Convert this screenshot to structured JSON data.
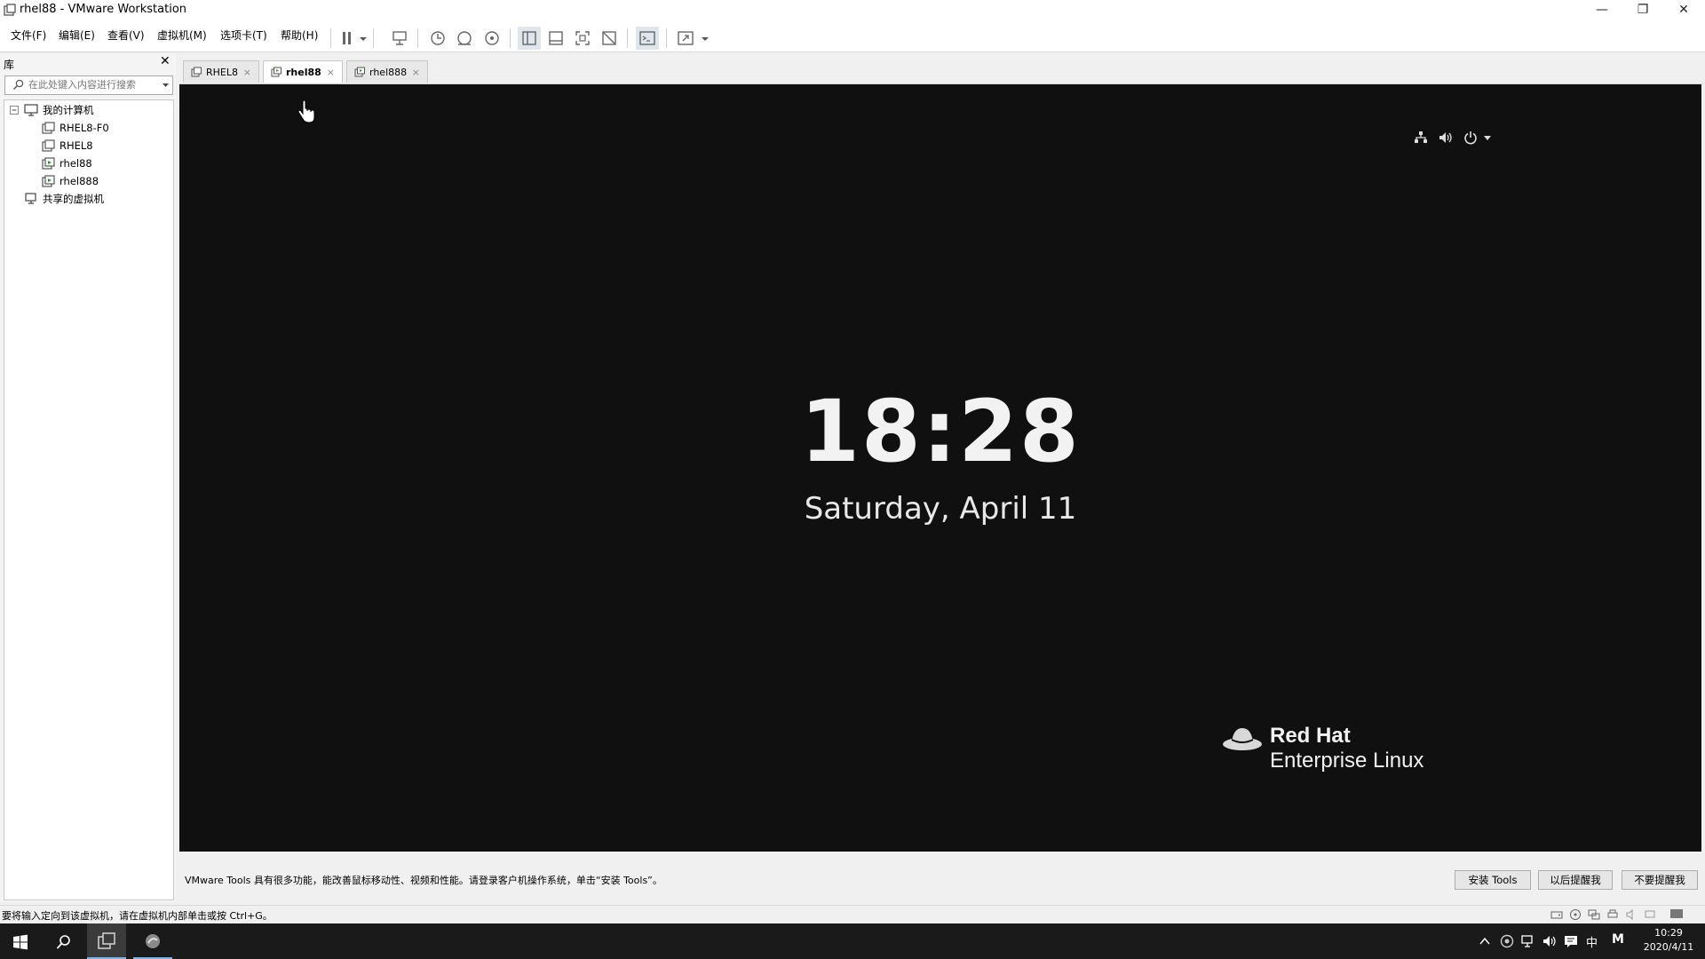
{
  "window": {
    "title": "rhel88 - VMware Workstation"
  },
  "menu": [
    "文件(F)",
    "编辑(E)",
    "查看(V)",
    "虚拟机(M)",
    "选项卡(T)",
    "帮助(H)"
  ],
  "library": {
    "title": "库",
    "search_placeholder": "在此处键入内容进行搜索",
    "root": "我的计算机",
    "vms": [
      "RHEL8-F0",
      "RHEL8",
      "rhel88",
      "rhel888"
    ],
    "shared": "共享的虚拟机"
  },
  "tabs": [
    {
      "label": "RHEL8",
      "active": false
    },
    {
      "label": "rhel88",
      "active": true
    },
    {
      "label": "rhel888",
      "active": false
    }
  ],
  "vm_screen": {
    "time": "18:28",
    "date": "Saturday, April 11",
    "brand_line1": "Red Hat",
    "brand_line2": "Enterprise Linux",
    "bg_color": "#111010"
  },
  "notification": {
    "text": "VMware Tools 具有很多功能，能改善鼠标移动性、视频和性能。请登录客户机操作系统，单击“安装 Tools”。",
    "install_button": "安装 Tools",
    "later_button": "以后提醒我",
    "never_button": "不要提醒我"
  },
  "status_bar": {
    "text": "要将输入定向到该虚拟机，请在虚拟机内部单击或按 Ctrl+G。"
  },
  "taskbar": {
    "ime": "中",
    "ime2": "M",
    "time": "10:29",
    "date": "2020/4/11"
  }
}
